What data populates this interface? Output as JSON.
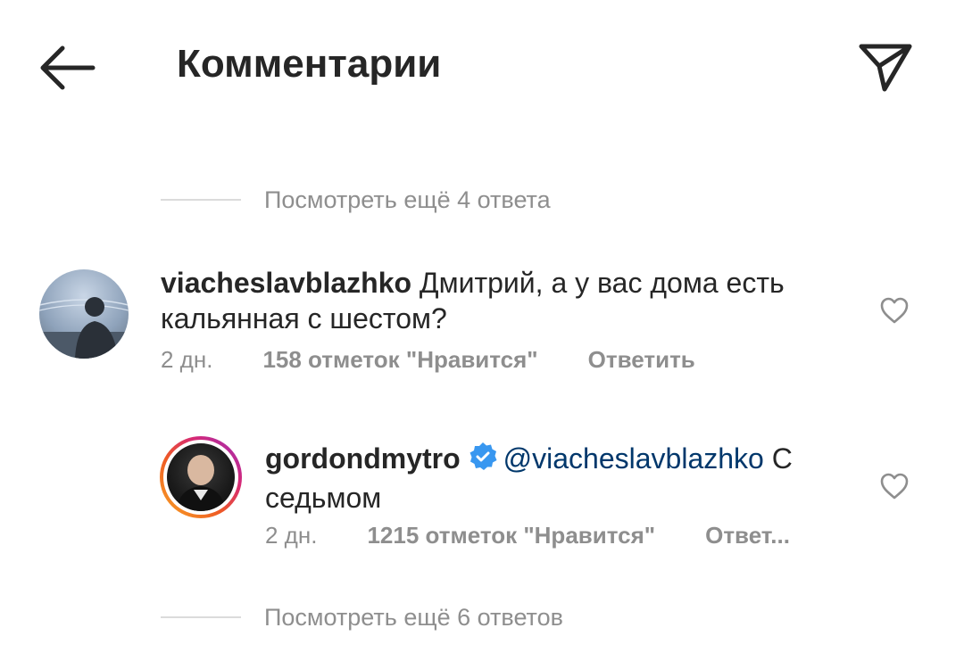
{
  "header": {
    "title": "Комментарии",
    "back_icon": "arrow-left-icon",
    "send_icon": "paper-plane-icon"
  },
  "view_more_top": "Посмотреть ещё 4 ответа",
  "comments": [
    {
      "username": "viacheslavblazhko",
      "text": "Дмитрий, а у вас дома есть кальянная с шестом?",
      "time": "2 дн.",
      "likes": "158 отметок \"Нравится\"",
      "reply": "Ответить"
    },
    {
      "username": "gordondmytro",
      "verified": true,
      "mention": "@viacheslavblazhko",
      "text": "С седьмом",
      "time": "2 дн.",
      "likes": "1215 отметок \"Нравится\"",
      "reply": "Ответ..."
    }
  ],
  "view_more_bottom": "Посмотреть ещё 6 ответов",
  "colors": {
    "text": "#262626",
    "muted": "#8e8e8e",
    "mention": "#00376b",
    "verified": "#3897f0"
  }
}
